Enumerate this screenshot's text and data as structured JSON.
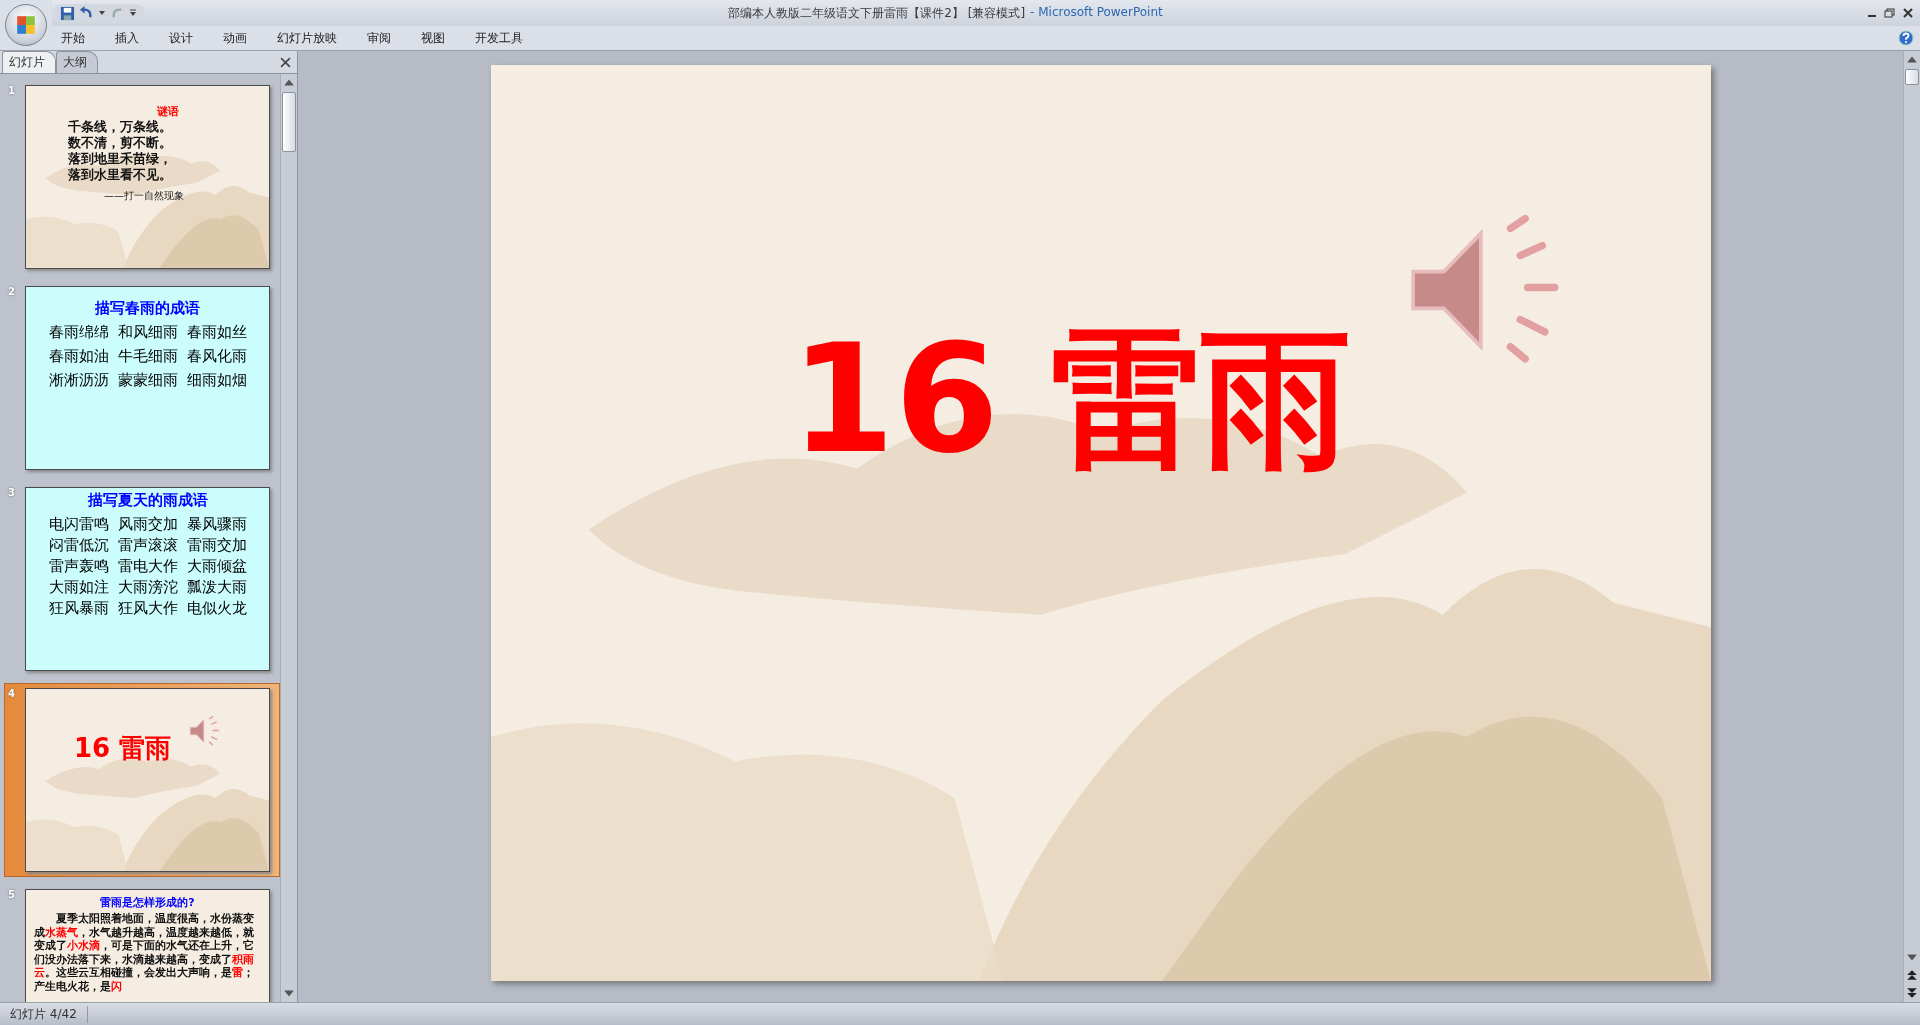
{
  "window": {
    "title": "部编本人教版二年级语文下册雷雨【课件2】 [兼容模式]",
    "app_name": "- Microsoft PowerPoint"
  },
  "ribbon_tabs": [
    {
      "label": "开始"
    },
    {
      "label": "插入"
    },
    {
      "label": "设计"
    },
    {
      "label": "动画"
    },
    {
      "label": "幻灯片放映"
    },
    {
      "label": "审阅"
    },
    {
      "label": "视图"
    },
    {
      "label": "开发工具"
    }
  ],
  "panel_tabs": [
    {
      "label": "幻灯片",
      "selected": true
    },
    {
      "label": "大纲",
      "selected": false
    }
  ],
  "slides": [
    {
      "number": "1",
      "kind": "riddle",
      "selected": false,
      "heading": "谜语",
      "lines": [
        "千条线，万条线。",
        "数不清，剪不断。",
        "落到地里禾苗绿，",
        "落到水里看不见。"
      ],
      "note": "——打一自然现象"
    },
    {
      "number": "2",
      "kind": "idioms",
      "selected": false,
      "heading": "描写春雨的成语",
      "rows": [
        [
          "春雨绵绵",
          "和风细雨",
          "春雨如丝"
        ],
        [
          "春雨如油",
          "牛毛细雨",
          "春风化雨"
        ],
        [
          "淅淅沥沥",
          "蒙蒙细雨",
          "细雨如烟"
        ]
      ]
    },
    {
      "number": "3",
      "kind": "idioms",
      "selected": false,
      "heading": "描写夏天的雨成语",
      "rows": [
        [
          "电闪雷鸣",
          "风雨交加",
          "暴风骤雨"
        ],
        [
          "闷雷低沉",
          "雷声滚滚",
          "雷雨交加"
        ],
        [
          "雷声轰鸣",
          "雷电大作",
          "大雨倾盆"
        ],
        [
          "大雨如注",
          "大雨滂沱",
          "瓢泼大雨"
        ],
        [
          "狂风暴雨",
          "狂风大作",
          "电似火龙"
        ]
      ]
    },
    {
      "number": "4",
      "kind": "title",
      "selected": true,
      "title": "16 雷雨",
      "sound": true
    },
    {
      "number": "5",
      "kind": "paragraph",
      "selected": false,
      "heading": "雷雨是怎样形成的?",
      "runs": [
        {
          "text": "夏季太阳照着地面，温度很高，水份蒸变成",
          "emphasis": false
        },
        {
          "text": "水蒸气",
          "emphasis": true
        },
        {
          "text": "，水气越升越高，温度越来越低，就变成了",
          "emphasis": false
        },
        {
          "text": "小水滴",
          "emphasis": true
        },
        {
          "text": "，可是下面的水气还在上升，它们没办法落下来，水滴越来越高，变成了",
          "emphasis": false
        },
        {
          "text": "积雨云",
          "emphasis": true
        },
        {
          "text": "。这些云互相碰撞，会发出大声响，是",
          "emphasis": false
        },
        {
          "text": "雷",
          "emphasis": true
        },
        {
          "text": "；产生电火花，是",
          "emphasis": false
        },
        {
          "text": "闪",
          "emphasis": true
        }
      ]
    }
  ],
  "current_slide": {
    "title": "16 雷雨",
    "sound": true
  },
  "status_bar": {
    "slide_position": "幻灯片 4/42"
  }
}
